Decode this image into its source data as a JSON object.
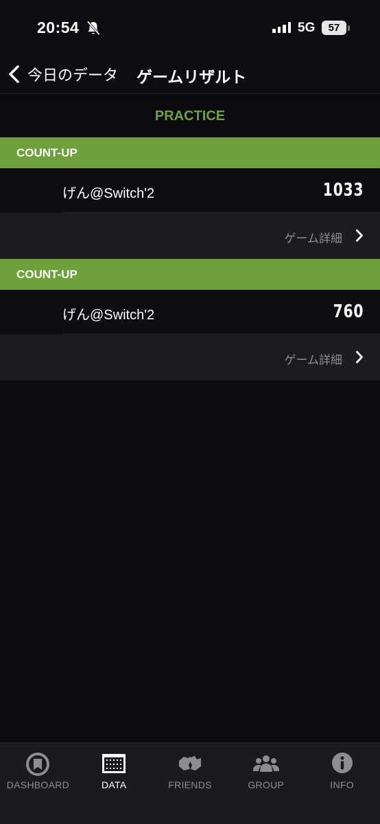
{
  "status_bar": {
    "time": "20:54",
    "network": "5G",
    "battery": "57"
  },
  "nav": {
    "back_label": "今日のデータ",
    "title": "ゲームリザルト"
  },
  "section_title": "PRACTICE",
  "games": [
    {
      "type": "COUNT-UP",
      "player": "げん@Switch'2",
      "score": "1033",
      "detail_label": "ゲーム詳細"
    },
    {
      "type": "COUNT-UP",
      "player": "げん@Switch'2",
      "score": "760",
      "detail_label": "ゲーム詳細"
    }
  ],
  "tabs": [
    {
      "label": "DASHBOARD",
      "icon": "dashboard-icon",
      "active": false
    },
    {
      "label": "DATA",
      "icon": "data-icon",
      "active": true
    },
    {
      "label": "FRIENDS",
      "icon": "friends-icon",
      "active": false
    },
    {
      "label": "GROUP",
      "icon": "group-icon",
      "active": false
    },
    {
      "label": "INFO",
      "icon": "info-icon",
      "active": false
    }
  ],
  "colors": {
    "accent": "#6da23a",
    "background": "#0c0c10",
    "detail_row": "#1b1c22",
    "tab_bar": "#1a1b21"
  }
}
